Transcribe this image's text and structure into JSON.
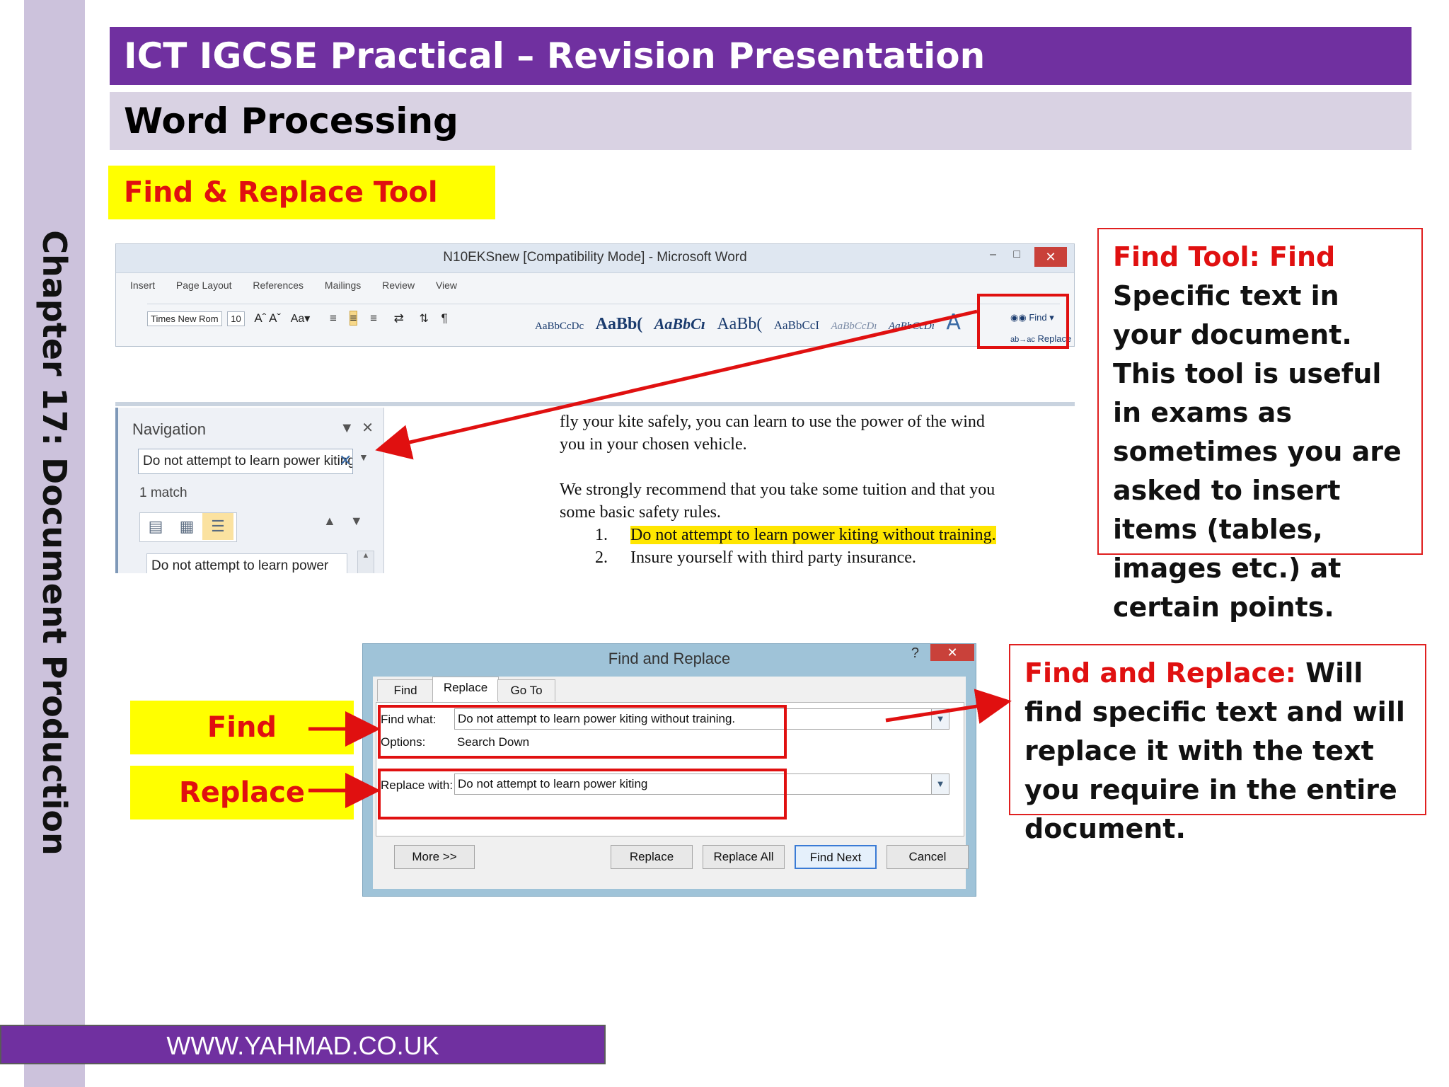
{
  "slide": {
    "title": "ICT IGCSE Practical – Revision Presentation",
    "subtitle": "Word Processing",
    "chapter": "Chapter 17: Document Production",
    "tool_heading": "Find & Replace Tool",
    "footer": "WWW.YAHMAD.CO.UK",
    "colors": {
      "purple": "#7030a0",
      "yellow": "#ffff00",
      "red": "#e01010",
      "lavender": "#ccc2dc"
    }
  },
  "callouts": {
    "find": {
      "title": "Find Tool: Find",
      "body": "Specific text in your document. This tool is useful in exams as sometimes you are asked to insert items (tables, images etc.) at certain points."
    },
    "replace": {
      "title": "Find and Replace:",
      "body": "Will find specific text and will replace it with the text you require in the entire document."
    }
  },
  "labels": {
    "find": "Find",
    "replace": "Replace"
  },
  "word": {
    "title": "N10EKSnew [Compatibility Mode] - Microsoft Word",
    "tabs": [
      "Insert",
      "Page Layout",
      "References",
      "Mailings",
      "Review",
      "View"
    ],
    "font_name": "Times New Rom",
    "font_size": "10",
    "styles": [
      "AaBbCcDc",
      "AaBb(",
      "AaBbCı",
      "AaBb(",
      "AaBbCcI",
      "AaBbCcDı",
      "AaBbCcDı"
    ],
    "find_button": "Find",
    "replace_button": "Replace",
    "navigation": {
      "title": "Navigation",
      "search_value": "Do not attempt to learn power kiting without training.",
      "match_text": "1 match",
      "result_text": "Do not attempt to learn power kiting without"
    },
    "document": {
      "para1": "fly your kite safely, you can learn to use the power of the wind",
      "para1b": "you in your chosen vehicle.",
      "para2": "We strongly recommend that you take some tuition and that you",
      "para2b": "some basic safety rules.",
      "list": [
        {
          "num": "1.",
          "text": "Do not attempt to learn power kiting without training."
        },
        {
          "num": "2.",
          "text": "Insure yourself with third party insurance."
        }
      ]
    }
  },
  "dialog": {
    "title": "Find and Replace",
    "help": "?",
    "tabs": [
      "Find",
      "Replace",
      "Go To"
    ],
    "find_label": "Find what:",
    "find_value": "Do not attempt to learn power kiting without training.",
    "options_label": "Options:",
    "options_value": "Search Down",
    "replace_label": "Replace with:",
    "replace_value": "Do not attempt to learn power kiting",
    "buttons": {
      "more": "More >>",
      "replace": "Replace",
      "replace_all": "Replace All",
      "find_next": "Find Next",
      "cancel": "Cancel"
    }
  }
}
